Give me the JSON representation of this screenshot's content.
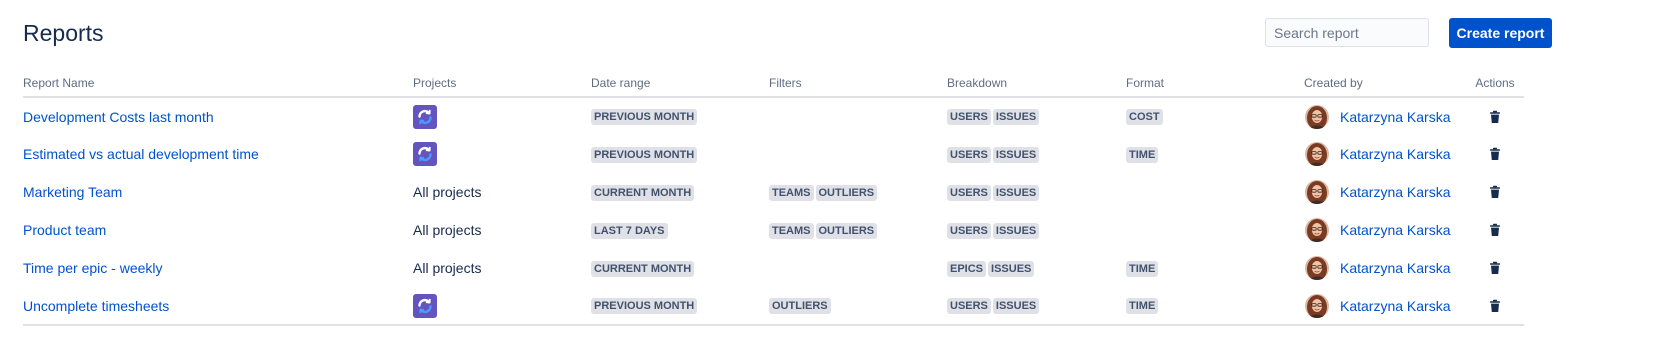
{
  "header": {
    "title": "Reports",
    "search_placeholder": "Search report",
    "create_label": "Create report"
  },
  "columns": {
    "name": "Report Name",
    "projects": "Projects",
    "date_range": "Date range",
    "filters": "Filters",
    "breakdown": "Breakdown",
    "format": "Format",
    "created_by": "Created by",
    "actions": "Actions"
  },
  "rows": [
    {
      "name": "Development Costs last month",
      "projects": {
        "type": "icon",
        "icon": "project-icon"
      },
      "date_range": "PREVIOUS MONTH",
      "filters": [],
      "breakdown": [
        "USERS",
        "ISSUES"
      ],
      "format": [
        "COST"
      ],
      "created_by": "Katarzyna Karska"
    },
    {
      "name": "Estimated vs actual development time",
      "projects": {
        "type": "icon",
        "icon": "project-icon"
      },
      "date_range": "PREVIOUS MONTH",
      "filters": [],
      "breakdown": [
        "USERS",
        "ISSUES"
      ],
      "format": [
        "TIME"
      ],
      "created_by": "Katarzyna Karska"
    },
    {
      "name": "Marketing Team",
      "projects": {
        "type": "text",
        "text": "All projects"
      },
      "date_range": "CURRENT MONTH",
      "filters": [
        "TEAMS",
        "OUTLIERS"
      ],
      "breakdown": [
        "USERS",
        "ISSUES"
      ],
      "format": [],
      "created_by": "Katarzyna Karska"
    },
    {
      "name": "Product team",
      "projects": {
        "type": "text",
        "text": "All projects"
      },
      "date_range": "LAST 7 DAYS",
      "filters": [
        "TEAMS",
        "OUTLIERS"
      ],
      "breakdown": [
        "USERS",
        "ISSUES"
      ],
      "format": [],
      "created_by": "Katarzyna Karska"
    },
    {
      "name": "Time per epic - weekly",
      "projects": {
        "type": "text",
        "text": "All projects"
      },
      "date_range": "CURRENT MONTH",
      "filters": [],
      "breakdown": [
        "EPICS",
        "ISSUES"
      ],
      "format": [
        "TIME"
      ],
      "created_by": "Katarzyna Karska"
    },
    {
      "name": "Uncomplete timesheets",
      "projects": {
        "type": "icon",
        "icon": "project-icon"
      },
      "date_range": "PREVIOUS MONTH",
      "filters": [
        "OUTLIERS"
      ],
      "breakdown": [
        "USERS",
        "ISSUES"
      ],
      "format": [
        "TIME"
      ],
      "created_by": "Katarzyna Karska"
    }
  ],
  "colors": {
    "primary": "#0052cc",
    "link": "#0052cc",
    "lozenge_bg": "#dfe1e6",
    "project_icon": "#6554c0"
  },
  "icons": {
    "delete": "trash-icon",
    "avatar": "user-avatar"
  }
}
